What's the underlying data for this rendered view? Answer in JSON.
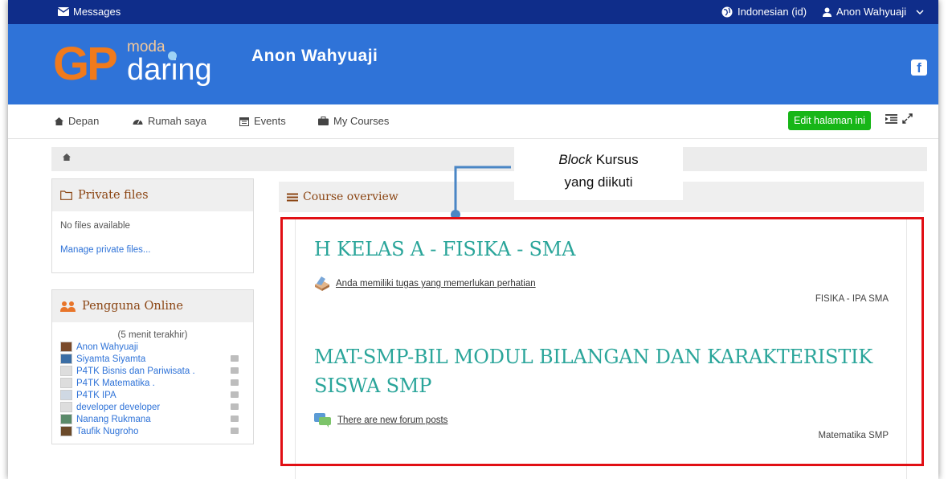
{
  "topbar": {
    "messages_label": "Messages",
    "language": "Indonesian (id)",
    "username": "Anon Wahyuaji",
    "icons": [
      "envelope-icon",
      "globe-icon",
      "user-icon",
      "chevron-down-icon"
    ]
  },
  "header": {
    "logo_gp": "GP",
    "logo_moda": "moda",
    "logo_daring": "daring",
    "site_name": "Anon Wahyuaji",
    "social_icon": "facebook-icon"
  },
  "nav": {
    "items": [
      {
        "label": "Depan",
        "icon": "home-icon"
      },
      {
        "label": "Rumah saya",
        "icon": "dashboard-icon"
      },
      {
        "label": "Events",
        "icon": "calendar-icon"
      },
      {
        "label": "My Courses",
        "icon": "briefcase-icon"
      }
    ],
    "edit_button": "Edit halaman ini",
    "right_icons": [
      "list-indent-icon",
      "expand-icon"
    ]
  },
  "breadcrumb": {
    "home_icon": "home-icon"
  },
  "private_files": {
    "title": "Private files",
    "empty_text": "No files available",
    "manage_link": "Manage private files..."
  },
  "online_users": {
    "title": "Pengguna Online",
    "subtitle": "(5 menit terakhir)",
    "users": [
      {
        "name": "Anon Wahyuaji",
        "chat": false
      },
      {
        "name": "Siyamta Siyamta",
        "chat": true
      },
      {
        "name": "P4TK Bisnis dan Pariwisata .",
        "chat": true
      },
      {
        "name": "P4TK Matematika .",
        "chat": true
      },
      {
        "name": "P4TK IPA",
        "chat": true
      },
      {
        "name": "developer developer",
        "chat": true
      },
      {
        "name": "Nanang Rukmana",
        "chat": true
      },
      {
        "name": "Taufik Nugroho",
        "chat": true
      }
    ]
  },
  "annotation": {
    "line1_italic": "Block",
    "line1_rest": "Kursus",
    "line2": "yang diikuti"
  },
  "course_overview": {
    "title": "Course overview",
    "courses": [
      {
        "title": "H KELAS A - FISIKA - SMA",
        "note": "Anda memiliki tugas yang memerlukan perhatian",
        "note_icon": "assignment-icon",
        "category": "FISIKA - IPA SMA"
      },
      {
        "title": "MAT-SMP-BIL MODUL BILANGAN DAN KARAKTERISTIK SISWA SMP",
        "note": "There are new forum posts",
        "note_icon": "forum-icon",
        "category": "Matematika SMP"
      }
    ]
  },
  "colors": {
    "topbar": "#0f2d8a",
    "header": "#2f73d8",
    "course_title": "#2aa59a",
    "edit_button": "#17b617",
    "highlight_box": "#e10f14",
    "logo_orange": "#f07a1c"
  }
}
